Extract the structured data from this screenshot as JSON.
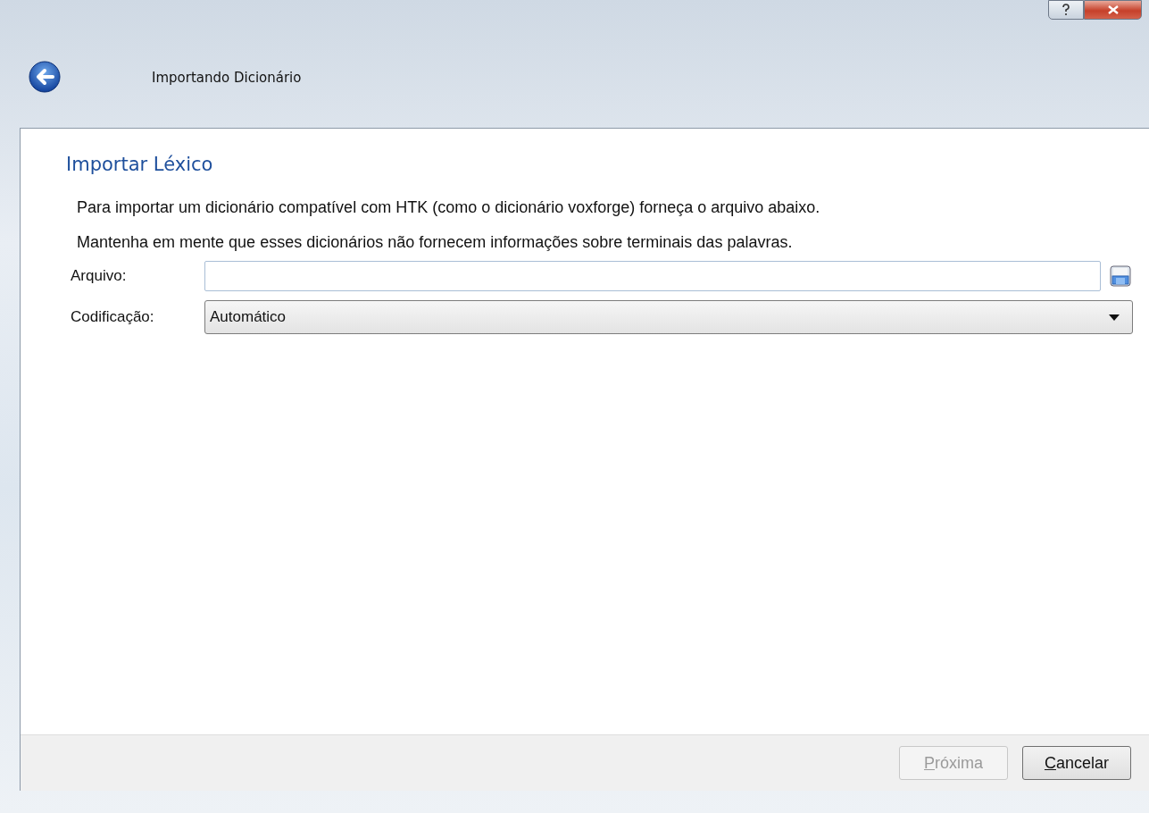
{
  "window": {
    "title": "Importando Dicionário"
  },
  "page": {
    "heading": "Importar Léxico",
    "paragraphs": [
      "Para importar um dicionário compatível com HTK (como o dicionário voxforge) forneça o arquivo abaixo.",
      "Mantenha em mente que esses dicionários não fornecem informações sobre terminais das palavras."
    ]
  },
  "form": {
    "file_label": "Arquivo:",
    "encoding_label": "Codificação:",
    "encoding_value": "Automático"
  },
  "buttons": [
    {
      "label": "Próxima",
      "disabled": true
    },
    {
      "label": "Cancelar",
      "disabled": false
    }
  ]
}
